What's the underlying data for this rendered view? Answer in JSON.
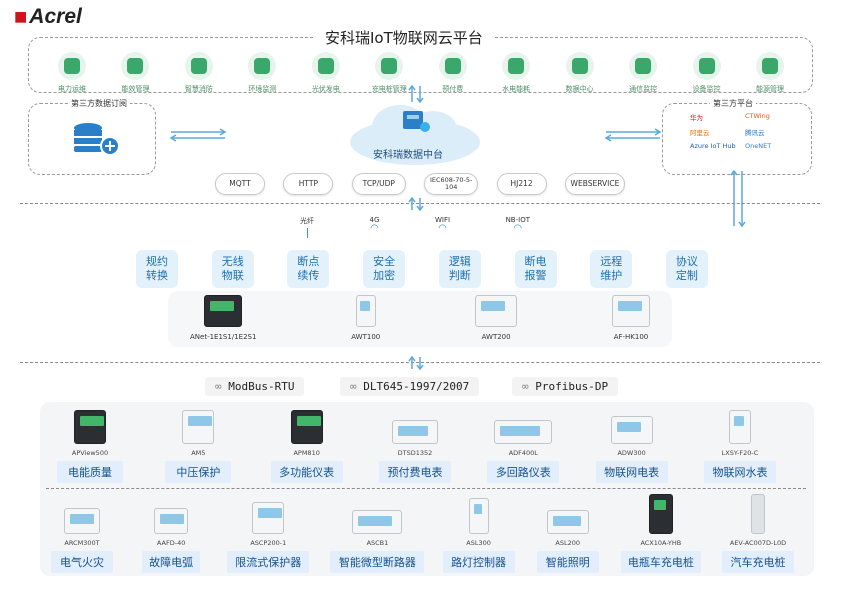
{
  "logo": {
    "text": "Acrel"
  },
  "platform": {
    "title": "安科瑞IoT物联网云平台",
    "services": [
      "电力运维",
      "能效管理",
      "智慧消防",
      "环境监测",
      "光伏发电",
      "充电桩管理",
      "预付费",
      "水电能耗",
      "数据中心",
      "通信监控",
      "设备监控",
      "能源管理"
    ]
  },
  "left_box": {
    "title": "第三方数据订阅"
  },
  "right_box": {
    "title": "第三方平台",
    "vendors": [
      "华为",
      "CTWing",
      "阿里云",
      "腾讯云",
      "Azure IoT Hub",
      "OneNET"
    ]
  },
  "data_center": {
    "label": "安科瑞数据中台"
  },
  "protocols": [
    "MQTT",
    "HTTP",
    "TCP/UDP",
    "IEC608-70-5-104",
    "HJ212",
    "WEBSERVICE"
  ],
  "networks": [
    "光纤",
    "4G",
    "WIFI",
    "NB-IOT"
  ],
  "gateway_features": [
    "规约\n转换",
    "无线\n物联",
    "断点\n续传",
    "安全\n加密",
    "逻辑\n判断",
    "断电\n报警",
    "远程\n维护",
    "协议\n定制"
  ],
  "gateways": [
    "ANet-1E1S1/1E2S1",
    "AWT100",
    "AWT200",
    "AF-HK100"
  ],
  "buses": [
    "ModBus-RTU",
    "DLT645-1997/2007",
    "Profibus-DP"
  ],
  "devices_row1": [
    {
      "model": "APView500",
      "label": "电能质量"
    },
    {
      "model": "AM5",
      "label": "中压保护"
    },
    {
      "model": "APM810",
      "label": "多功能仪表"
    },
    {
      "model": "DTSD1352",
      "label": "预付费电表"
    },
    {
      "model": "ADF400L",
      "label": "多回路仪表"
    },
    {
      "model": "ADW300",
      "label": "物联网电表"
    },
    {
      "model": "LXSY-F20-C",
      "label": "物联网水表"
    }
  ],
  "devices_row2": [
    {
      "model": "ARCM300T",
      "label": "电气火灾"
    },
    {
      "model": "AAFD-40",
      "label": "故障电弧"
    },
    {
      "model": "ASCP200-1",
      "label": "限流式保护器"
    },
    {
      "model": "ASCB1",
      "label": "智能微型断路器"
    },
    {
      "model": "ASL300",
      "label": "路灯控制器"
    },
    {
      "model": "ASL200",
      "label": "智能照明"
    },
    {
      "model": "ACX10A-YHB",
      "label": "电瓶车充电桩"
    },
    {
      "model": "AEV-AC007D-L0D",
      "label": "汽车充电桩"
    }
  ],
  "colors": {
    "accent": "#2a7fc8",
    "green": "#3aa86b",
    "brand": "#d0121b"
  }
}
